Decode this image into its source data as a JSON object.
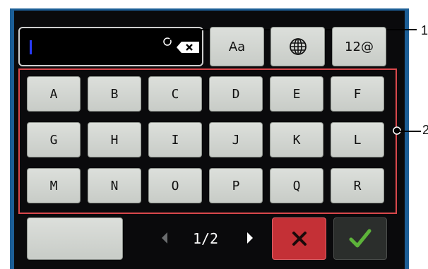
{
  "input": {
    "value": ""
  },
  "toolbar": {
    "case_label": "Aa",
    "numeric_label": "12@"
  },
  "keys": {
    "row1": [
      "A",
      "B",
      "C",
      "D",
      "E",
      "F"
    ],
    "row2": [
      "G",
      "H",
      "I",
      "J",
      "K",
      "L"
    ],
    "row3": [
      "M",
      "N",
      "O",
      "P",
      "Q",
      "R"
    ]
  },
  "pager": {
    "label": "1/2"
  },
  "callouts": [
    "1",
    "2"
  ],
  "icons": {
    "backspace": "backspace-icon",
    "globe": "globe-icon",
    "prev": "chevron-left-icon",
    "next": "chevron-right-icon",
    "cancel": "close-icon",
    "confirm": "checkmark-icon"
  },
  "colors": {
    "frame_border": "#1c5e96",
    "key_area_outline": "#d9484c",
    "cancel_bg": "#c43036",
    "confirm_check": "#5db33a",
    "cursor": "#2a3cff"
  }
}
